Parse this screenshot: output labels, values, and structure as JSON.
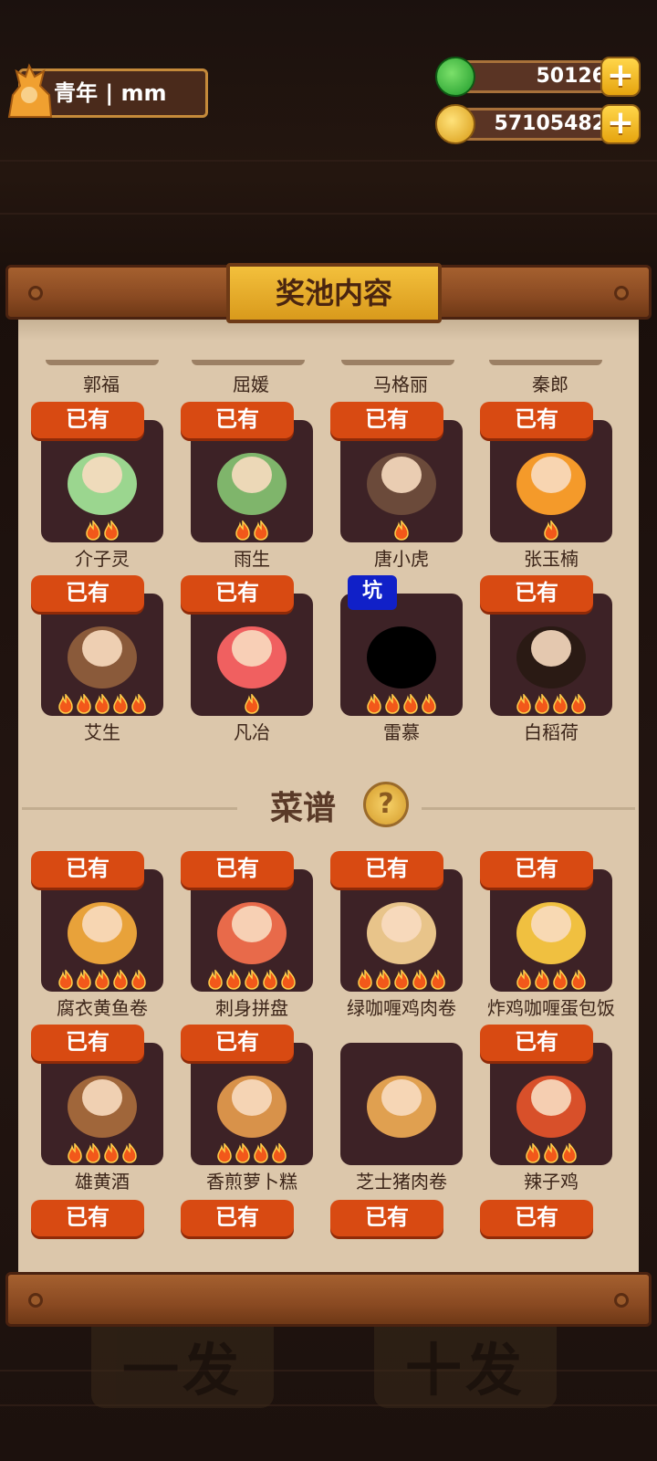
{
  "header": {
    "player_name": "青年 | mm",
    "jade_value": "50126",
    "coin_value": "57105482",
    "plus_label": "+"
  },
  "panel": {
    "title": "奖池内容",
    "prev_row_names": [
      "郭福",
      "屈媛",
      "马格丽",
      "秦郎"
    ],
    "owned_label": "已有",
    "pit_label": "坑",
    "chef_cards": [
      {
        "name": "介子灵",
        "tag": "已有",
        "flames": 2,
        "color": "#9bd68f"
      },
      {
        "name": "雨生",
        "tag": "已有",
        "flames": 2,
        "color": "#7fb56b"
      },
      {
        "name": "唐小虎",
        "tag": "已有",
        "flames": 1,
        "color": "#6b4a3a"
      },
      {
        "name": "张玉楠",
        "tag": "已有",
        "flames": 1,
        "color": "#f49a2a"
      },
      {
        "name": "艾生",
        "tag": "已有",
        "flames": 5,
        "color": "#8a5a3a"
      },
      {
        "name": "凡冶",
        "tag": "已有",
        "flames": 1,
        "color": "#f06060"
      },
      {
        "name": "雷慕",
        "tag": "坑",
        "flames": 4,
        "color": "#000000"
      },
      {
        "name": "白稻荷",
        "tag": "已有",
        "flames": 4,
        "color": "#2a1a14"
      }
    ],
    "recipe_section_title": "菜谱",
    "help_icon": "question-icon",
    "recipe_cards": [
      {
        "name": "腐衣黄鱼卷",
        "tag": "已有",
        "flames": 5,
        "color": "#e8a23a"
      },
      {
        "name": "刺身拼盘",
        "tag": "已有",
        "flames": 5,
        "color": "#e86a4a"
      },
      {
        "name": "绿咖喱鸡肉卷",
        "tag": "已有",
        "flames": 5,
        "color": "#e8c48a"
      },
      {
        "name": "炸鸡咖喱蛋包饭",
        "tag": "已有",
        "flames": 4,
        "color": "#f0c040"
      },
      {
        "name": "雄黄酒",
        "tag": "已有",
        "flames": 4,
        "color": "#a0663a"
      },
      {
        "name": "香煎萝卜糕",
        "tag": "已有",
        "flames": 4,
        "color": "#d8924a"
      },
      {
        "name": "芝士猪肉卷",
        "tag": "",
        "flames": 0,
        "color": "#e0a050"
      },
      {
        "name": "辣子鸡",
        "tag": "已有",
        "flames": 3,
        "color": "#d8502a"
      }
    ],
    "next_row_tags": [
      "已有",
      "已有",
      "已有",
      "已有"
    ]
  },
  "background_buttons": [
    "一发",
    "十发"
  ]
}
